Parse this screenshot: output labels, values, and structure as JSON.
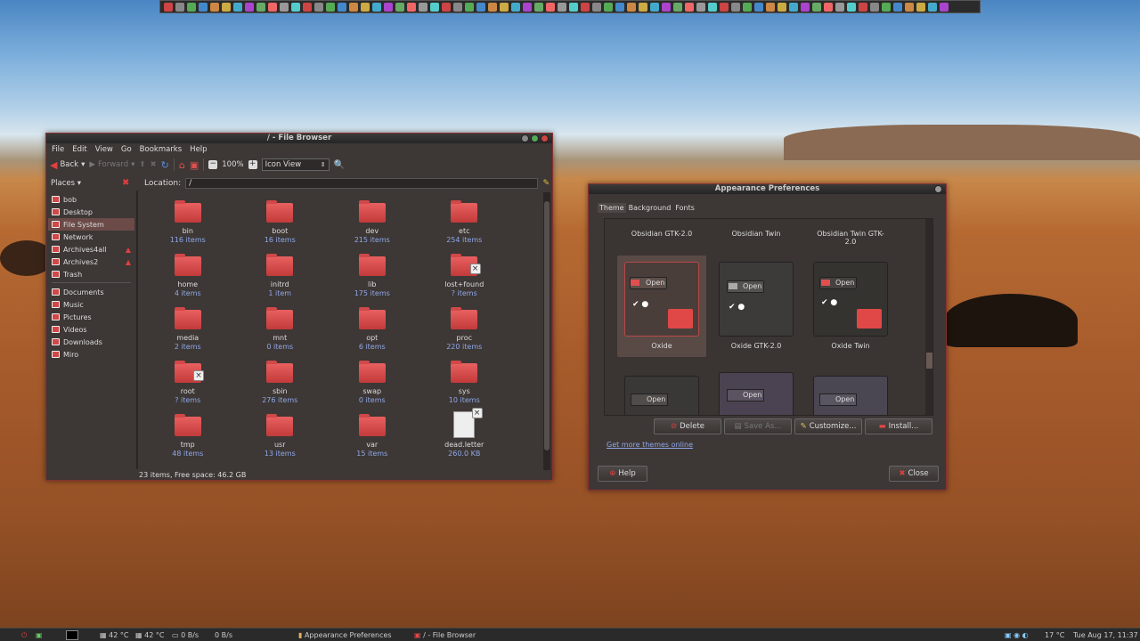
{
  "top_panel": {
    "launchers": [
      "terminal-icon",
      "monitor-icon",
      "app-icon",
      "app-icon",
      "app-icon",
      "app-icon",
      "web-icon",
      "app-icon",
      "app-icon",
      "app-icon",
      "app-icon",
      "app-icon",
      "app-icon",
      "app-icon",
      "app-icon",
      "app-icon",
      "app-icon",
      "app-icon",
      "app-icon",
      "app-icon",
      "app-icon",
      "app-icon",
      "app-icon",
      "app-icon",
      "app-icon",
      "app-icon",
      "app-icon",
      "app-icon",
      "app-icon",
      "app-icon",
      "app-icon",
      "app-icon",
      "app-icon",
      "app-icon",
      "app-icon",
      "app-icon",
      "app-icon",
      "app-icon",
      "app-icon",
      "app-icon",
      "app-icon",
      "app-icon",
      "app-icon",
      "app-icon",
      "app-icon",
      "app-icon",
      "app-icon",
      "app-icon",
      "app-icon",
      "app-icon",
      "app-icon",
      "app-icon",
      "app-icon",
      "app-icon",
      "app-icon",
      "app-icon",
      "app-icon",
      "app-icon",
      "app-icon",
      "app-icon",
      "app-icon",
      "app-icon",
      "app-icon",
      "app-icon",
      "app-icon",
      "app-icon",
      "app-icon",
      "app-icon"
    ]
  },
  "file_browser": {
    "title": "/ - File Browser",
    "menu": [
      "File",
      "Edit",
      "View",
      "Go",
      "Bookmarks",
      "Help"
    ],
    "toolbar": {
      "back": "Back",
      "forward": "Forward",
      "zoom": "100%",
      "view_mode": "Icon View"
    },
    "places_label": "Places",
    "location_label": "Location:",
    "location_value": "/",
    "places": [
      {
        "label": "bob",
        "eject": false
      },
      {
        "label": "Desktop",
        "eject": false
      },
      {
        "label": "File System",
        "eject": false
      },
      {
        "label": "Network",
        "eject": false
      },
      {
        "label": "Archives4all",
        "eject": true
      },
      {
        "label": "Archives2",
        "eject": true
      },
      {
        "label": "Trash",
        "eject": false
      }
    ],
    "bookmarks": [
      "Documents",
      "Music",
      "Pictures",
      "Videos",
      "Downloads",
      "Miro"
    ],
    "items": [
      {
        "name": "bin",
        "count": "116 items"
      },
      {
        "name": "boot",
        "count": "16 items"
      },
      {
        "name": "dev",
        "count": "215 items"
      },
      {
        "name": "etc",
        "count": "254 items"
      },
      {
        "name": "home",
        "count": "4 items"
      },
      {
        "name": "initrd",
        "count": "1 item"
      },
      {
        "name": "lib",
        "count": "175 items"
      },
      {
        "name": "lost+found",
        "count": "? items",
        "locked": true
      },
      {
        "name": "media",
        "count": "2 items"
      },
      {
        "name": "mnt",
        "count": "0 items"
      },
      {
        "name": "opt",
        "count": "6 items"
      },
      {
        "name": "proc",
        "count": "220 items"
      },
      {
        "name": "root",
        "count": "? items",
        "locked": true
      },
      {
        "name": "sbin",
        "count": "276 items"
      },
      {
        "name": "swap",
        "count": "0 items"
      },
      {
        "name": "sys",
        "count": "10 items"
      },
      {
        "name": "tmp",
        "count": "48 items"
      },
      {
        "name": "usr",
        "count": "13 items"
      },
      {
        "name": "var",
        "count": "15 items"
      },
      {
        "name": "dead.letter",
        "count": "260.0 KB",
        "file": true,
        "locked": true
      }
    ],
    "status": "23 items, Free space: 46.2 GB"
  },
  "appearance": {
    "title": "Appearance Preferences",
    "tabs": [
      "Theme",
      "Background",
      "Fonts"
    ],
    "themes_row0": [
      "Obsidian GTK-2.0",
      "Obsidian Twin",
      "Obsidian Twin GTK-2.0"
    ],
    "themes_row1": [
      "Oxide",
      "Oxide GTK-2.0",
      "Oxide Twin"
    ],
    "preview_open": "Open",
    "buttons": {
      "delete": "Delete",
      "save_as": "Save As...",
      "customize": "Customize...",
      "install": "Install..."
    },
    "link": "Get more themes online",
    "help": "Help",
    "close": "Close"
  },
  "bottom_panel": {
    "temp1": "42 °C",
    "temp2": "42 °C",
    "net1": "0 B/s",
    "net2": "0 B/s",
    "task1": "Appearance Preferences",
    "task2": "/ - File Browser",
    "weather": "17 °C",
    "clock": "Tue Aug 17, 11:37"
  },
  "colors": {
    "accent": "#d04848",
    "link": "#8fa8e8",
    "window_bg": "#3d3735"
  }
}
